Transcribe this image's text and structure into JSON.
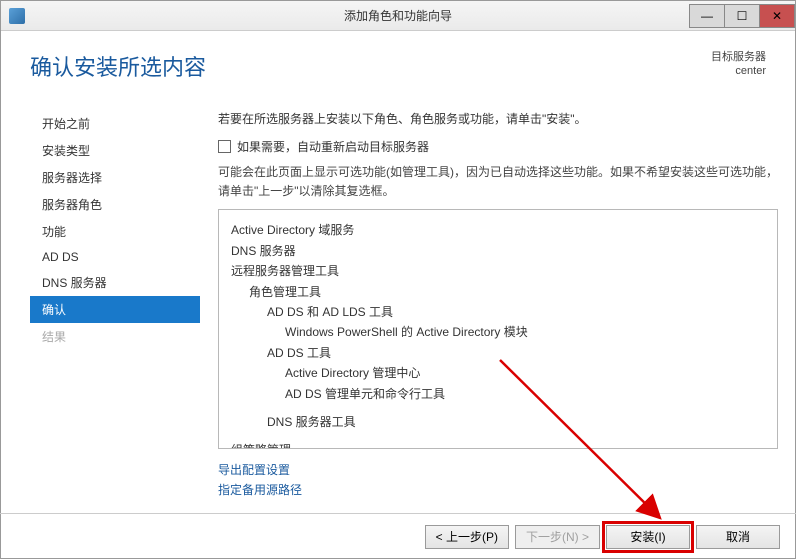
{
  "titlebar": {
    "title": "添加角色和功能向导"
  },
  "header": {
    "page_title": "确认安装所选内容",
    "target_label": "目标服务器",
    "target_name": "center"
  },
  "sidebar": {
    "items": [
      {
        "label": "开始之前"
      },
      {
        "label": "安装类型"
      },
      {
        "label": "服务器选择"
      },
      {
        "label": "服务器角色"
      },
      {
        "label": "功能"
      },
      {
        "label": "AD DS"
      },
      {
        "label": "DNS 服务器"
      },
      {
        "label": "确认"
      },
      {
        "label": "结果"
      }
    ]
  },
  "main": {
    "instruction": "若要在所选服务器上安装以下角色、角色服务或功能，请单击\"安装\"。",
    "checkbox_label": "如果需要，自动重新启动目标服务器",
    "note": "可能会在此页面上显示可选功能(如管理工具)，因为已自动选择这些功能。如果不希望安装这些可选功能，请单击\"上一步\"以清除其复选框。",
    "roles": {
      "r0": "Active Directory 域服务",
      "r1": "DNS 服务器",
      "r2": "远程服务器管理工具",
      "r3": "角色管理工具",
      "r4": "AD DS 和 AD LDS 工具",
      "r5": "Windows PowerShell 的 Active Directory 模块",
      "r6": "AD DS 工具",
      "r7": "Active Directory 管理中心",
      "r8": "AD DS 管理单元和命令行工具",
      "r9": "DNS 服务器工具",
      "r10": "组策略管理"
    },
    "links": {
      "export": "导出配置设置",
      "altsrc": "指定备用源路径"
    }
  },
  "footer": {
    "prev": "< 上一步(P)",
    "next": "下一步(N) >",
    "install": "安装(I)",
    "cancel": "取消"
  }
}
